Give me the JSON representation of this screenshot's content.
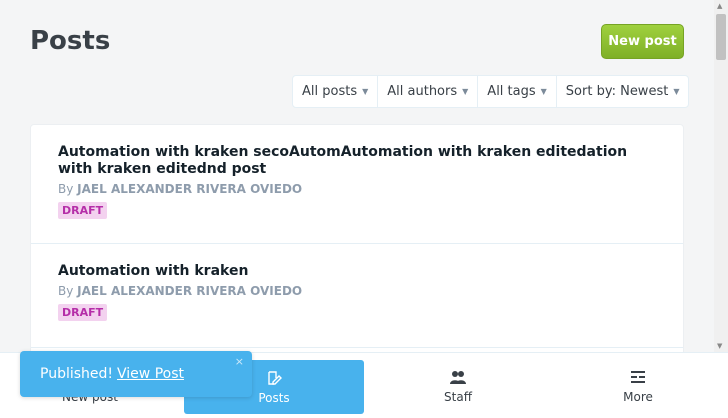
{
  "header": {
    "title": "Posts",
    "new_post_label": "New post"
  },
  "filters": [
    {
      "label": "All posts"
    },
    {
      "label": "All authors"
    },
    {
      "label": "All tags"
    },
    {
      "label": "Sort by: Newest"
    }
  ],
  "posts": [
    {
      "title": "Automation with kraken secoAutomAutomation with kraken editedation with kraken editednd post",
      "by": "By",
      "author": "JAEL ALEXANDER RIVERA OVIEDO",
      "status": "DRAFT"
    },
    {
      "title": "Automation with kraken",
      "by": "By",
      "author": "JAEL ALEXANDER RIVERA OVIEDO",
      "status": "DRAFT"
    }
  ],
  "bottom_nav": [
    {
      "label": "New post",
      "icon": "pencil-icon"
    },
    {
      "label": "Posts",
      "icon": "posts-icon"
    },
    {
      "label": "Staff",
      "icon": "people-icon"
    },
    {
      "label": "More",
      "icon": "menu-icon"
    }
  ],
  "toast": {
    "message": "Published!",
    "link": "View Post",
    "close": "×"
  },
  "colors": {
    "accent": "#48b2ed",
    "green": "#9fd13e",
    "draft_badge": "#f3d2ef"
  }
}
